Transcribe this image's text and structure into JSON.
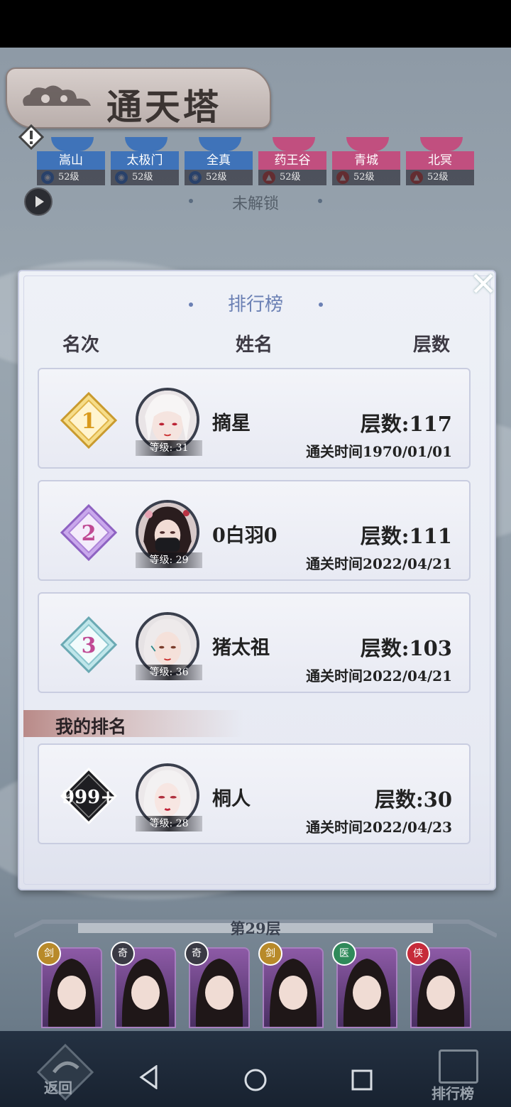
{
  "game_title": "通天塔",
  "sects": [
    {
      "name": "嵩山",
      "level": "52级",
      "color": "#3f73b9",
      "element": "water"
    },
    {
      "name": "太极门",
      "level": "52级",
      "color": "#3f73b9",
      "element": "water"
    },
    {
      "name": "全真",
      "level": "52级",
      "color": "#3f73b9",
      "element": "water"
    },
    {
      "name": "药王谷",
      "level": "52级",
      "color": "#c14f7f",
      "element": "fire"
    },
    {
      "name": "青城",
      "level": "52级",
      "color": "#c14f7f",
      "element": "fire"
    },
    {
      "name": "北冥",
      "level": "52级",
      "color": "#c14f7f",
      "element": "fire"
    }
  ],
  "locked_text": "未解锁",
  "leaderboard": {
    "title": "排行榜",
    "headers": {
      "rank": "名次",
      "name": "姓名",
      "floors": "层数"
    },
    "entries": [
      {
        "rank": "1",
        "name": "摘星",
        "level": "等级: 31",
        "floors": "层数:117",
        "time": "通关时间1970/01/01",
        "badge_color": "#f2c95a"
      },
      {
        "rank": "2",
        "name": "0白羽0",
        "level": "等级: 29",
        "floors": "层数:111",
        "time": "通关时间2022/04/21",
        "badge_color": "#b38ad9"
      },
      {
        "rank": "3",
        "name": "猪太祖",
        "level": "等级: 36",
        "floors": "层数:103",
        "time": "通关时间2022/04/21",
        "badge_color": "#9fd3dc"
      }
    ],
    "my_rank_label": "我的排名",
    "my_entry": {
      "rank": "999+",
      "name": "桐人",
      "level": "等级: 28",
      "floors": "层数:30",
      "time": "通关时间2022/04/23"
    }
  },
  "floor_label": "第29层",
  "bottom_badges": [
    "剑",
    "奇",
    "奇",
    "剑",
    "医",
    "侠"
  ],
  "nav": {
    "back_label": "返回",
    "leaderboard_label": "排行榜"
  }
}
